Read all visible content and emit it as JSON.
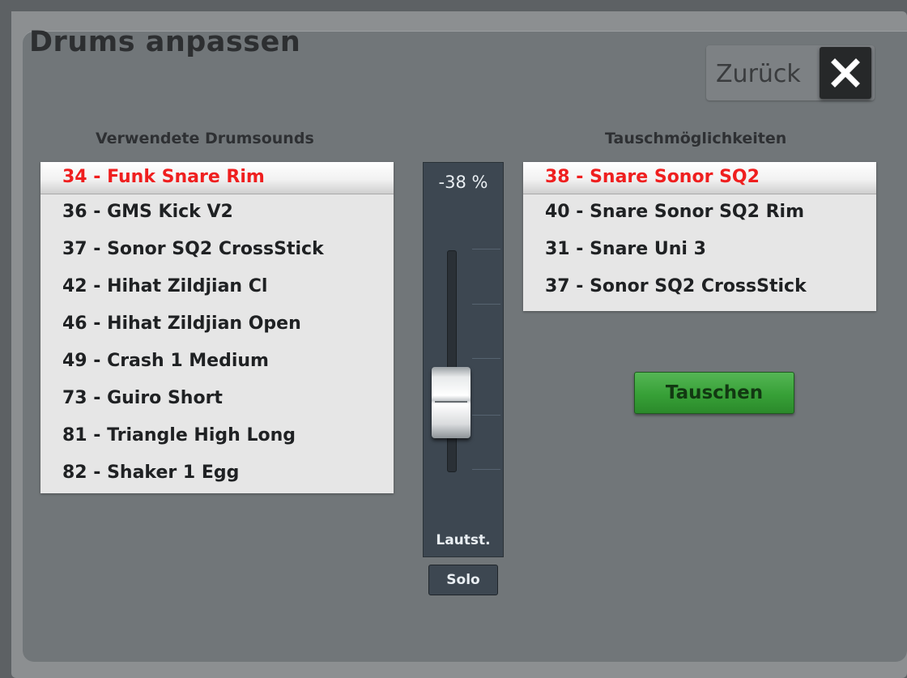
{
  "window": {
    "title": "Drums anpassen"
  },
  "header": {
    "back_label": "Zurück",
    "close_icon": "close-icon"
  },
  "left": {
    "heading": "Verwendete Drumsounds",
    "items": [
      {
        "label": "34 - Funk Snare Rim",
        "selected": true
      },
      {
        "label": "36 - GMS Kick V2",
        "selected": false
      },
      {
        "label": "37 - Sonor SQ2 CrossStick",
        "selected": false
      },
      {
        "label": "42 - Hihat Zildjian Cl",
        "selected": false
      },
      {
        "label": "46 - Hihat Zildjian Open",
        "selected": false
      },
      {
        "label": "49 - Crash 1 Medium",
        "selected": false
      },
      {
        "label": "73 - Guiro Short",
        "selected": false
      },
      {
        "label": "81 - Triangle High Long",
        "selected": false
      },
      {
        "label": "82 - Shaker 1 Egg",
        "selected": false
      }
    ]
  },
  "fader": {
    "value": "-38 %",
    "label": "Lautst.",
    "solo_label": "Solo"
  },
  "right": {
    "heading": "Tauschmöglichkeiten",
    "items": [
      {
        "label": "38 - Snare Sonor SQ2",
        "selected": true
      },
      {
        "label": "40 - Snare Sonor SQ2 Rim",
        "selected": false
      },
      {
        "label": "31 - Snare Uni 3",
        "selected": false
      },
      {
        "label": "37 - Sonor SQ2 CrossStick",
        "selected": false
      }
    ],
    "swap_label": "Tauschen"
  },
  "colors": {
    "selected_text": "#ef1f1f",
    "swap_button": "#37a037",
    "fader_bg": "#3d4751",
    "panel_bg": "#717679"
  }
}
